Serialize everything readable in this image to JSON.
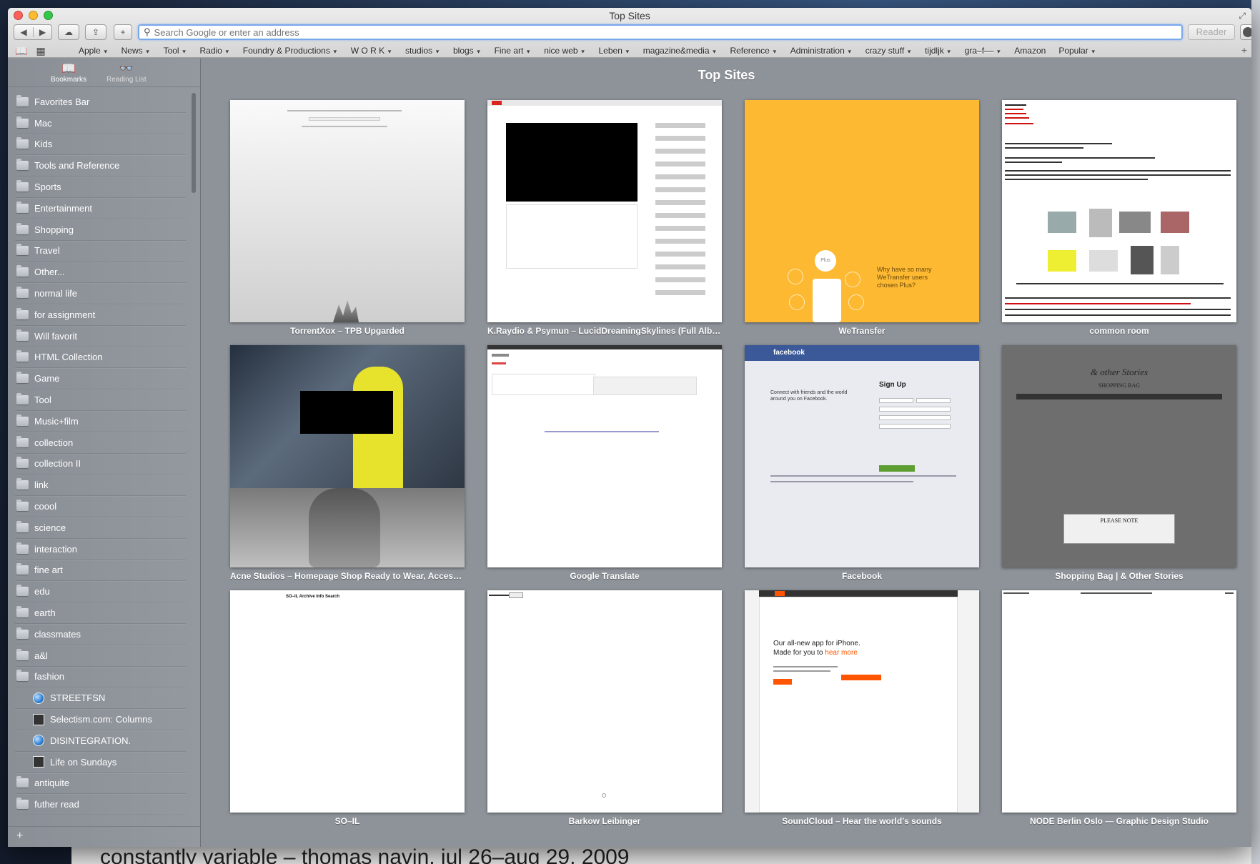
{
  "window": {
    "title": "Top Sites",
    "fullscreen_icon": "arrows-icon"
  },
  "toolbar": {
    "back_icon": "◀",
    "forward_icon": "▶",
    "cloud_icon": "☁",
    "share_icon": "⇪",
    "add_icon": "+",
    "address_placeholder": "Search Google or enter an address",
    "reader_label": "Reader"
  },
  "bookmarks_bar": {
    "items": [
      {
        "label": "Apple",
        "menu": true
      },
      {
        "label": "News",
        "menu": true
      },
      {
        "label": "Tool",
        "menu": true
      },
      {
        "label": "Radio",
        "menu": true
      },
      {
        "label": "Foundry & Productions",
        "menu": true
      },
      {
        "label": "W O R K",
        "menu": true
      },
      {
        "label": "studios",
        "menu": true
      },
      {
        "label": "blogs",
        "menu": true
      },
      {
        "label": "Fine art",
        "menu": true
      },
      {
        "label": "nice web",
        "menu": true
      },
      {
        "label": "Leben",
        "menu": true
      },
      {
        "label": "magazine&media",
        "menu": true
      },
      {
        "label": "Reference",
        "menu": true
      },
      {
        "label": "Administration",
        "menu": true
      },
      {
        "label": "crazy stuff",
        "menu": true
      },
      {
        "label": "tijdljk",
        "menu": true
      },
      {
        "label": "gra–f––",
        "menu": true
      },
      {
        "label": "Amazon",
        "menu": false
      },
      {
        "label": "Popular",
        "menu": true
      }
    ]
  },
  "sidebar": {
    "tabs": [
      {
        "label": "Bookmarks",
        "icon": "book-icon"
      },
      {
        "label": "Reading List",
        "icon": "glasses-icon"
      }
    ],
    "items": [
      {
        "label": "Favorites Bar",
        "type": "folder"
      },
      {
        "label": "Mac",
        "type": "folder"
      },
      {
        "label": "Kids",
        "type": "folder"
      },
      {
        "label": "Tools and Reference",
        "type": "folder"
      },
      {
        "label": "Sports",
        "type": "folder"
      },
      {
        "label": "Entertainment",
        "type": "folder"
      },
      {
        "label": "Shopping",
        "type": "folder"
      },
      {
        "label": "Travel",
        "type": "folder"
      },
      {
        "label": "Other...",
        "type": "folder"
      },
      {
        "label": "normal life",
        "type": "folder"
      },
      {
        "label": "for assignment",
        "type": "folder"
      },
      {
        "label": "Will favorit",
        "type": "folder"
      },
      {
        "label": "HTML Collection",
        "type": "folder"
      },
      {
        "label": "Game",
        "type": "folder"
      },
      {
        "label": "Tool",
        "type": "folder"
      },
      {
        "label": "Music+film",
        "type": "folder"
      },
      {
        "label": "collection",
        "type": "folder"
      },
      {
        "label": "collection II",
        "type": "folder"
      },
      {
        "label": "link",
        "type": "folder"
      },
      {
        "label": "coool",
        "type": "folder"
      },
      {
        "label": "science",
        "type": "folder"
      },
      {
        "label": "interaction",
        "type": "folder"
      },
      {
        "label": "fine art",
        "type": "folder"
      },
      {
        "label": "edu",
        "type": "folder"
      },
      {
        "label": "earth",
        "type": "folder"
      },
      {
        "label": "classmates",
        "type": "folder"
      },
      {
        "label": "a&l",
        "type": "folder"
      },
      {
        "label": "fashion",
        "type": "folder"
      },
      {
        "label": "STREETFSN",
        "type": "globe"
      },
      {
        "label": "Selectism.com: Columns",
        "type": "square"
      },
      {
        "label": "DISINTEGRATION.",
        "type": "globe"
      },
      {
        "label": "Life on Sundays",
        "type": "square"
      },
      {
        "label": "antiquite",
        "type": "folder"
      },
      {
        "label": "futher read",
        "type": "folder"
      }
    ],
    "footer_add": "+"
  },
  "top_sites": {
    "title": "Top Sites",
    "tiles": [
      {
        "label": "TorrentXox – TPB Upgarded"
      },
      {
        "label": "K.Raydio & Psymun – LucidDreamingSkylines (Full Album Stream)"
      },
      {
        "label": "WeTransfer",
        "thumb_text": "Why have so many WeTransfer users chosen Plus?",
        "badge": "Plus"
      },
      {
        "label": "common room"
      },
      {
        "label": "Acne Studios – Homepage Shop Ready to Wear, Accessories, Shoes"
      },
      {
        "label": "Google Translate"
      },
      {
        "label": "Facebook",
        "thumb_head": "facebook",
        "thumb_signup": "Sign Up",
        "thumb_text": "Connect with friends and the world around you on Facebook."
      },
      {
        "label": "Shopping Bag | & Other Stories",
        "thumb_title": "& other Stories",
        "thumb_bag": "SHOPPING BAG",
        "thumb_note": "PLEASE NOTE"
      },
      {
        "label": "SO–IL",
        "thumb_nav": "SO–IL   Archive   Info   Search"
      },
      {
        "label": "Barkow Leibinger"
      },
      {
        "label": "SoundCloud – Hear the world's sounds",
        "thumb_line1": "Our all-new app for iPhone.",
        "thumb_line2": "Made for you to",
        "thumb_link": "hear more"
      },
      {
        "label": "NODE Berlin Oslo — Graphic Design Studio"
      }
    ]
  },
  "background_page_text": "constantly variable – thomas navin, jul 26–aug 29, 2009"
}
